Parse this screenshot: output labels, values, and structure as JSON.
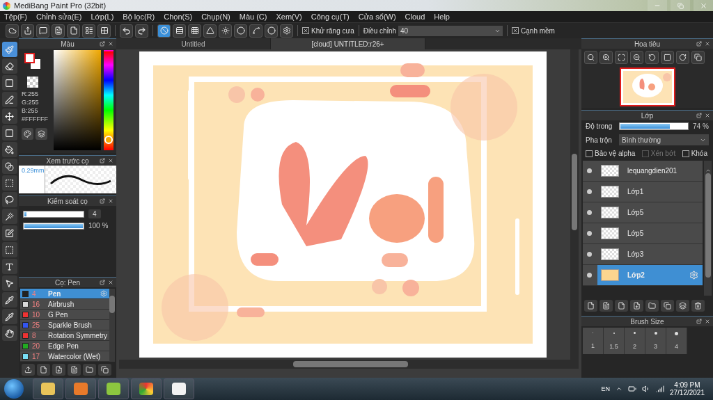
{
  "window": {
    "title": "MediBang Paint Pro (32bit)"
  },
  "menu": [
    "Tệp(F)",
    "Chỉnh sửa(E)",
    "Lớp(L)",
    "Bộ lọc(R)",
    "Chọn(S)",
    "Chụp(N)",
    "Màu (C)",
    "Xem(V)",
    "Công cụ(T)",
    "Cửa sổ(W)",
    "Cloud",
    "Help"
  ],
  "snap_buttons": [
    {
      "kind": "off",
      "selected": true
    },
    {
      "kind": "parallel",
      "selected": false
    },
    {
      "kind": "grid",
      "selected": false
    },
    {
      "kind": "perspective",
      "selected": false
    },
    {
      "kind": "radial",
      "selected": false
    },
    {
      "kind": "concentric",
      "selected": false
    },
    {
      "kind": "curve",
      "selected": false
    },
    {
      "kind": "circle",
      "selected": false
    },
    {
      "kind": "settings",
      "selected": false
    }
  ],
  "toolbar": {
    "antialias": {
      "label": "Khử răng cưa",
      "checked": true
    },
    "correction": {
      "label": "Điều chỉnh",
      "value": "40"
    },
    "soft_edge": {
      "label": "Cạnh mềm",
      "checked": true
    }
  },
  "tools": [
    {
      "kind": "brush",
      "selected": true
    },
    {
      "kind": "eraser",
      "selected": false
    },
    {
      "kind": "shape",
      "selected": false
    },
    {
      "kind": "pen",
      "selected": false
    },
    {
      "kind": "move",
      "selected": false
    },
    {
      "kind": "fill-rect",
      "selected": false
    },
    {
      "kind": "bucket",
      "selected": false
    },
    {
      "kind": "gradient",
      "selected": false
    },
    {
      "kind": "select",
      "selected": false
    },
    {
      "kind": "lasso",
      "selected": false
    },
    {
      "kind": "wand",
      "selected": false
    },
    {
      "kind": "select-pen",
      "selected": false
    },
    {
      "kind": "select-eraser",
      "selected": false
    },
    {
      "kind": "text",
      "selected": false
    },
    {
      "kind": "operation",
      "selected": false
    },
    {
      "kind": "dropper",
      "selected": false
    },
    {
      "kind": "pipette",
      "selected": false
    },
    {
      "kind": "hand",
      "selected": false
    }
  ],
  "color_panel": {
    "title": "Màu",
    "hue": {
      "level": 0.05
    },
    "r": "R:255",
    "g": "G:255",
    "b": "B:255",
    "hex": "#FFFFFF"
  },
  "brush_preview": {
    "title": "Xem trước cọ",
    "size": "0.29mm"
  },
  "brush_control": {
    "title": "Kiểm soát cọ",
    "sliders": [
      {
        "level": 0.03,
        "reading": "4"
      },
      {
        "level": 1,
        "reading": "100 %"
      }
    ]
  },
  "brush_list": {
    "title": "Cọ: Pen",
    "items": [
      {
        "size": "4",
        "name": "Pen",
        "color": "#222222",
        "selected": true
      },
      {
        "size": "16",
        "name": "Airbrush",
        "color": "#d8d8d8",
        "selected": false
      },
      {
        "size": "10",
        "name": "G Pen",
        "color": "#ee3333",
        "selected": false
      },
      {
        "size": "25",
        "name": "Sparkle Brush",
        "color": "#3355ee",
        "selected": false
      },
      {
        "size": "8",
        "name": "Rotation Symmetry",
        "color": "#ee3333",
        "selected": false
      },
      {
        "size": "20",
        "name": "Edge Pen",
        "color": "#22aa22",
        "selected": false
      },
      {
        "size": "17",
        "name": "Watercolor (Wet)",
        "color": "#77ddf5",
        "selected": false
      }
    ]
  },
  "tabs": [
    {
      "label": "Untitled",
      "selected": false
    },
    {
      "label": "[cloud] UNTITLED:r26+",
      "selected": true
    }
  ],
  "navigator": {
    "title": "Hoa tiêu"
  },
  "layers": {
    "title": "Lớp",
    "opacity": {
      "label": "Độ trong",
      "level": 0.74,
      "reading": "74 %"
    },
    "blend": {
      "label": "Pha trộn",
      "value": "Bình thường"
    },
    "options": [
      {
        "label": "Bảo vệ alpha",
        "checked": false,
        "disabled": false
      },
      {
        "label": "Xén bớt",
        "checked": false,
        "disabled": true
      },
      {
        "label": "Khóa",
        "checked": false,
        "disabled": false
      }
    ],
    "items": [
      {
        "name": "lequangdien201",
        "selected": false
      },
      {
        "name": "Lớp1",
        "selected": false
      },
      {
        "name": "Lớp5",
        "selected": false
      },
      {
        "name": "Lớp5",
        "selected": false
      },
      {
        "name": "Lớp3",
        "selected": false
      },
      {
        "name": "Lớp2",
        "selected": true
      }
    ]
  },
  "brush_size": {
    "title": "Brush Size",
    "sizes": [
      "1",
      "1.5",
      "2",
      "3",
      "4"
    ]
  },
  "taskbar": {
    "language": "EN",
    "time": "4:09 PM",
    "date": "27/12/2021"
  }
}
